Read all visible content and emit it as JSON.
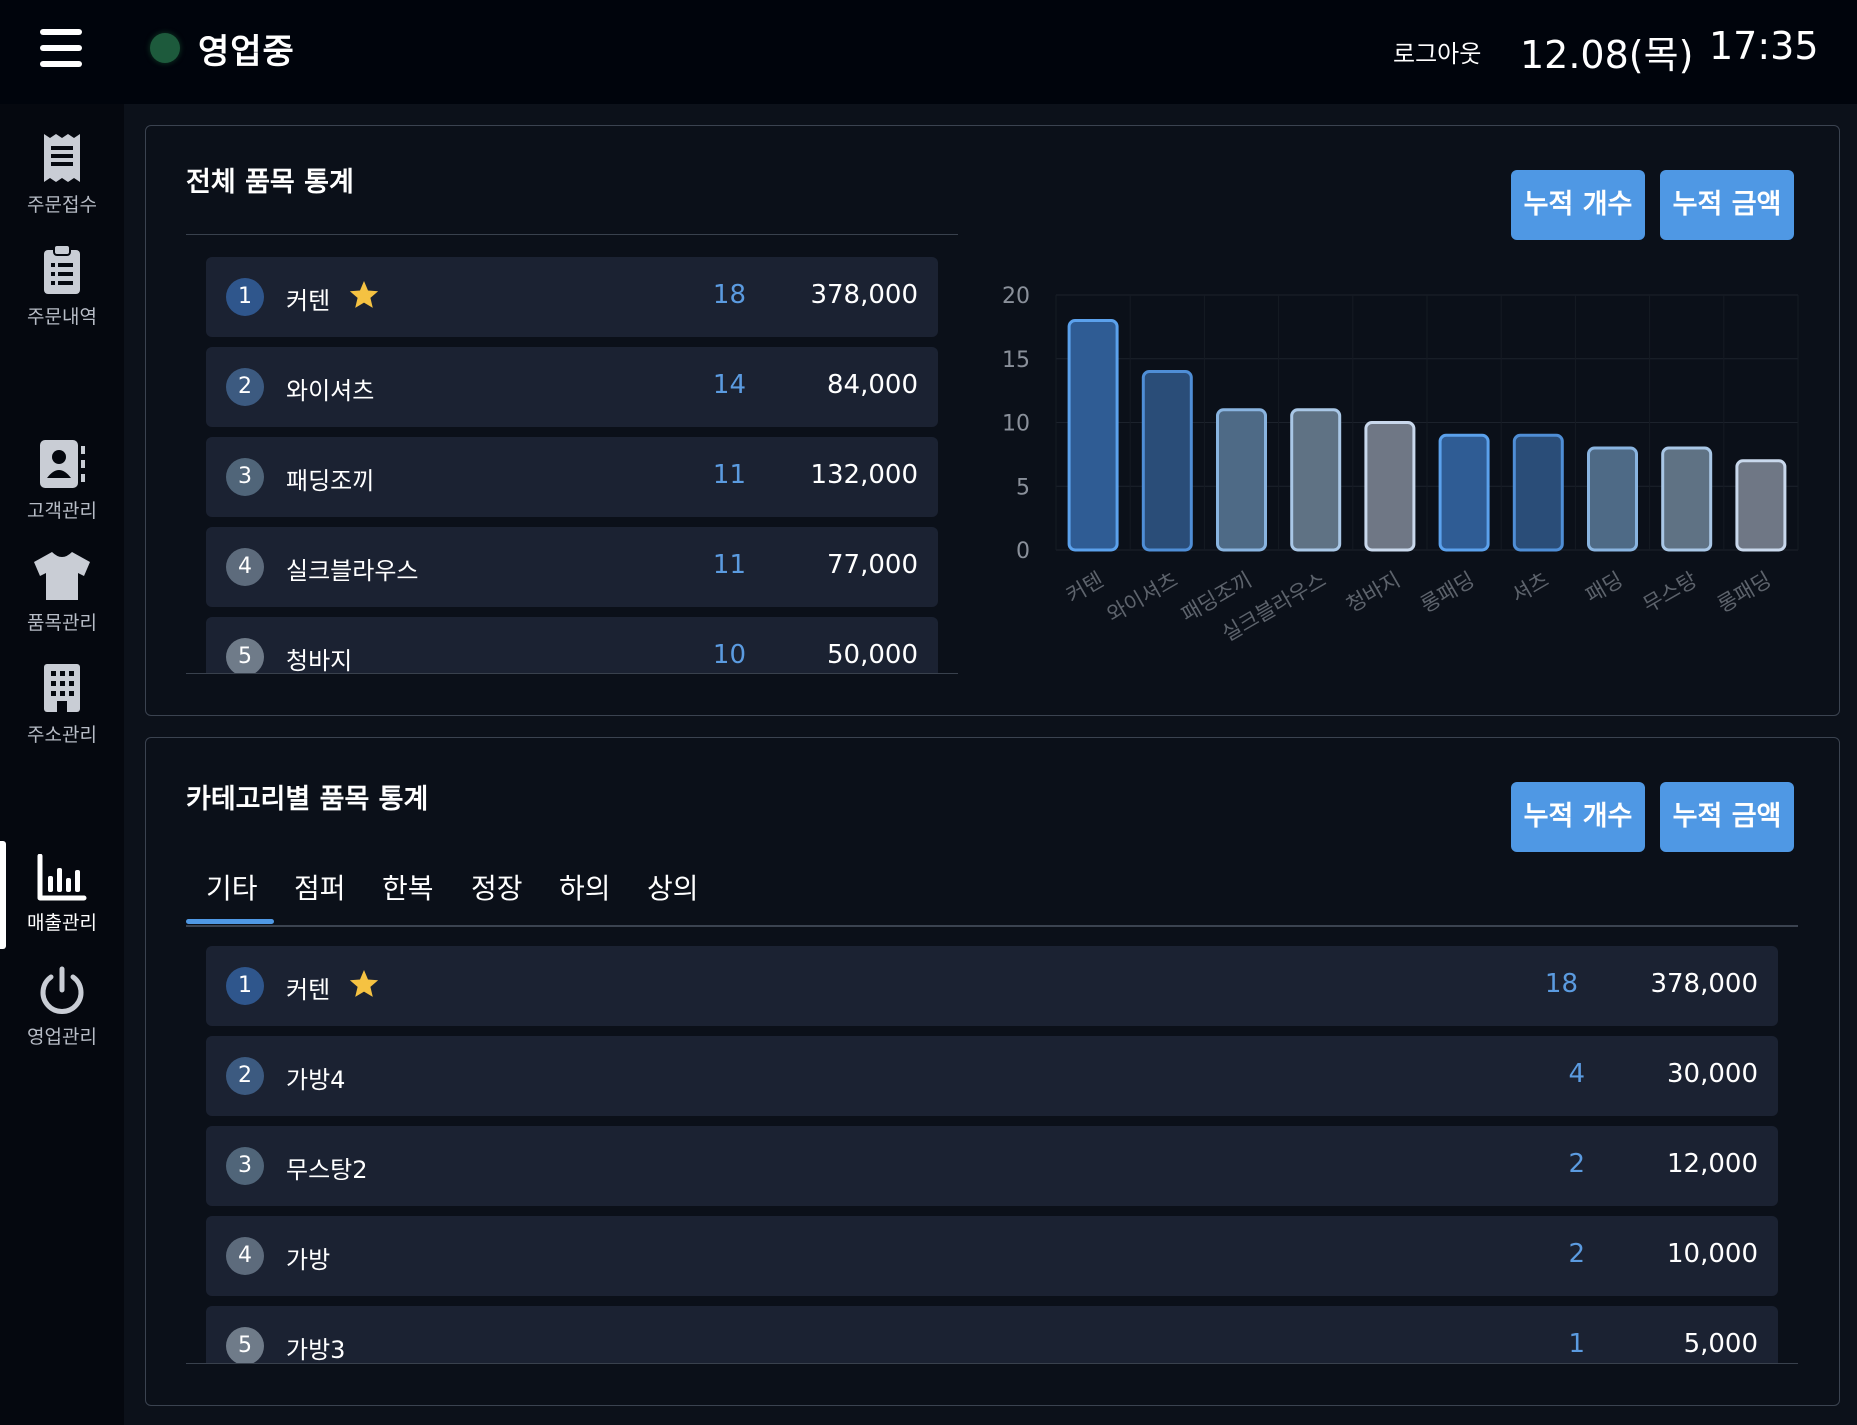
{
  "header": {
    "status": "영업중",
    "logout": "로그아웃",
    "date": "12.08(목)",
    "time": "17:35",
    "status_color": "#1d5a3c"
  },
  "sidebar": {
    "items": [
      {
        "label": "주문접수",
        "icon": "receipt-icon"
      },
      {
        "label": "주문내역",
        "icon": "clipboard-icon"
      },
      {
        "label": "고객관리",
        "icon": "contact-icon"
      },
      {
        "label": "품목관리",
        "icon": "shirt-icon"
      },
      {
        "label": "주소관리",
        "icon": "building-icon"
      },
      {
        "label": "매출관리",
        "icon": "bar-chart-icon",
        "active": true
      },
      {
        "label": "영업관리",
        "icon": "power-icon"
      }
    ]
  },
  "overall": {
    "title": "전체 품목 통계",
    "btn_count": "누적 개수",
    "btn_amount": "누적 금액",
    "rows": [
      {
        "rank": "1",
        "name": "커텐",
        "star": true,
        "count": "18",
        "amount": "378,000"
      },
      {
        "rank": "2",
        "name": "와이셔츠",
        "count": "14",
        "amount": "84,000"
      },
      {
        "rank": "3",
        "name": "패딩조끼",
        "count": "11",
        "amount": "132,000"
      },
      {
        "rank": "4",
        "name": "실크블라우스",
        "count": "11",
        "amount": "77,000"
      },
      {
        "rank": "5",
        "name": "청바지",
        "count": "10",
        "amount": "50,000"
      }
    ]
  },
  "chart_data": {
    "type": "bar",
    "categories": [
      "커텐",
      "와이셔츠",
      "패딩조끼",
      "실크블라우스",
      "청바지",
      "롱패딩",
      "셔츠",
      "패딩",
      "무스탕",
      "롱패딩"
    ],
    "values": [
      18,
      14,
      11,
      11,
      10,
      9,
      9,
      8,
      8,
      7
    ],
    "yticks": [
      "0",
      "5",
      "10",
      "15",
      "20"
    ],
    "ylim": [
      0,
      20
    ],
    "grid": true,
    "title": "",
    "xlabel": "",
    "ylabel": "",
    "colors": [
      "#2f5c94",
      "#2a4d78",
      "#4e6a86",
      "#5f7284",
      "#6f7785",
      "#2f5c94",
      "#2a4d78",
      "#4e6a86",
      "#5f7284",
      "#6f7785"
    ],
    "stroke_colors": [
      "#5ba1ec",
      "#4f8ed6",
      "#89b4e0",
      "#a9c7e6",
      "#c9d8ec",
      "#5ba1ec",
      "#4f8ed6",
      "#89b4e0",
      "#a9c7e6",
      "#c9d8ec"
    ]
  },
  "category": {
    "title": "카테고리별 품목 통계",
    "btn_count": "누적 개수",
    "btn_amount": "누적 금액",
    "tabs": [
      "기타",
      "점퍼",
      "한복",
      "정장",
      "하의",
      "상의"
    ],
    "rows": [
      {
        "rank": "1",
        "name": "커텐",
        "star": true,
        "count": "18",
        "amount": "378,000"
      },
      {
        "rank": "2",
        "name": "가방4",
        "count": "4",
        "amount": "30,000"
      },
      {
        "rank": "3",
        "name": "무스탕2",
        "count": "2",
        "amount": "12,000"
      },
      {
        "rank": "4",
        "name": "가방",
        "count": "2",
        "amount": "10,000"
      },
      {
        "rank": "5",
        "name": "가방3",
        "count": "1",
        "amount": "5,000"
      }
    ]
  },
  "colors": {
    "accent": "#4f98e4",
    "count_text": "#5b9be0",
    "row_bg": "#1b2232",
    "star": "#f5c242"
  }
}
